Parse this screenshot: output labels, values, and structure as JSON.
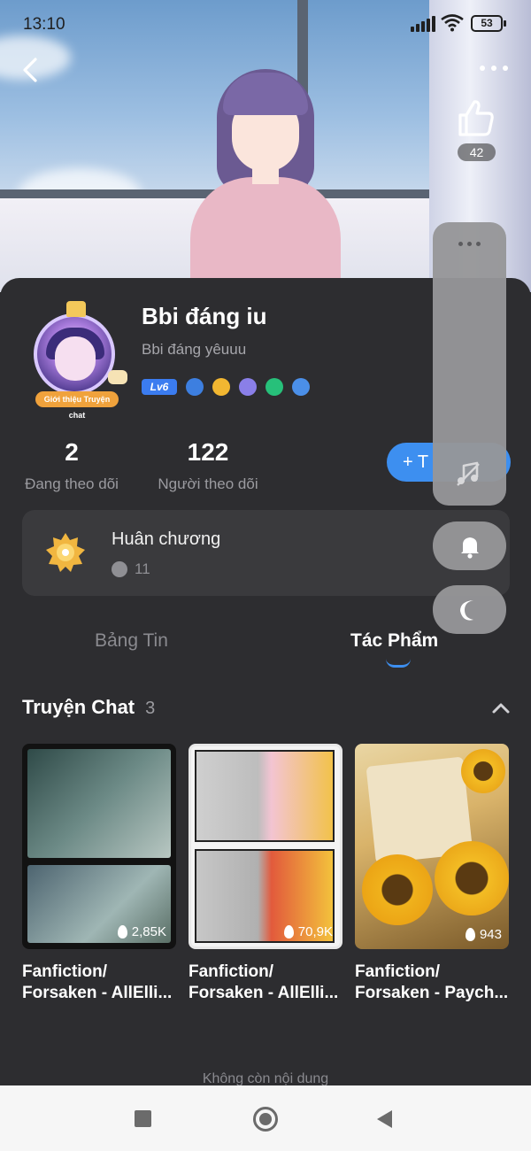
{
  "status_bar": {
    "time": "13:10",
    "battery": "53"
  },
  "header": {
    "likes": "42"
  },
  "profile": {
    "name": "Bbi đáng iu",
    "bio": "Bbi đáng yêuuu",
    "level": "Lv6",
    "avatar_badge": "Giới thiệu Truyện chat"
  },
  "stats": [
    {
      "value": "2",
      "label": "Đang theo dõi"
    },
    {
      "value": "122",
      "label": "Người theo dõi"
    }
  ],
  "follow_button": {
    "label": "+ T"
  },
  "medal": {
    "title": "Huân chương",
    "count": "11"
  },
  "tabs": [
    {
      "label": "Bảng Tin",
      "active": false
    },
    {
      "label": "Tác Phẩm",
      "active": true
    }
  ],
  "section": {
    "title": "Truyện Chat",
    "count": "3"
  },
  "stories": [
    {
      "title": "Fanfiction/",
      "title2": "Forsaken - AllElli...",
      "views": "2,85K"
    },
    {
      "title": "Fanfiction/",
      "title2": "Forsaken - AllElli...",
      "views": "70,9K"
    },
    {
      "title": "Fanfiction/",
      "title2": "Forsaken - Paych...",
      "views": "943"
    }
  ],
  "footer": {
    "end_text": "Không còn nội dung"
  },
  "colors": {
    "accent": "#3d8ff0",
    "panel": "#2d2d30",
    "card": "#3a3a3d"
  }
}
